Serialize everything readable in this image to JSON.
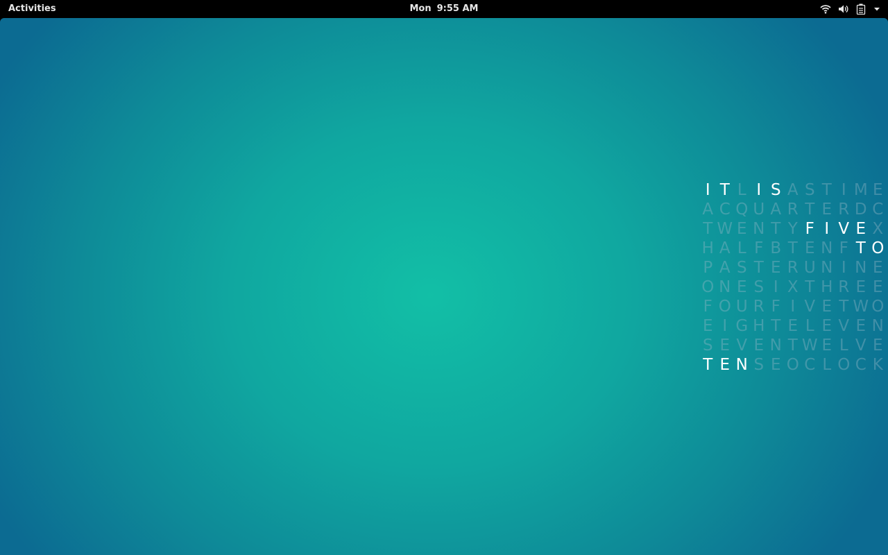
{
  "topbar": {
    "activities_label": "Activities",
    "clock": {
      "day": "Mon",
      "time": "9:55 AM"
    },
    "tray": [
      {
        "name": "wifi-icon"
      },
      {
        "name": "volume-icon"
      },
      {
        "name": "battery-icon"
      },
      {
        "name": "chevron-down-icon"
      }
    ]
  },
  "desktop": {
    "background_colors": {
      "center": "#12bfa6",
      "edge": "#0c6b92"
    },
    "word_clock": {
      "text_color_lit": "#ffffff",
      "text_color_dim": "rgba(150,185,200,0.38)",
      "rows": [
        {
          "letters": "ITLISASTIME",
          "lit": [
            0,
            1,
            3,
            4
          ]
        },
        {
          "letters": "ACQUARTERDC",
          "lit": []
        },
        {
          "letters": "TWENTYFIVEX",
          "lit": [
            6,
            7,
            8,
            9
          ]
        },
        {
          "letters": "HALFBTENFTO",
          "lit": [
            9,
            10
          ]
        },
        {
          "letters": "PASTERUNINE",
          "lit": []
        },
        {
          "letters": "ONESIXTHREE",
          "lit": []
        },
        {
          "letters": "FOURFIVETWO",
          "lit": []
        },
        {
          "letters": "EIGHTELEVEN",
          "lit": []
        },
        {
          "letters": "SEVENTWELVE",
          "lit": []
        },
        {
          "letters": "TENSEOCLOCK",
          "lit": [
            0,
            1,
            2
          ]
        }
      ]
    }
  }
}
